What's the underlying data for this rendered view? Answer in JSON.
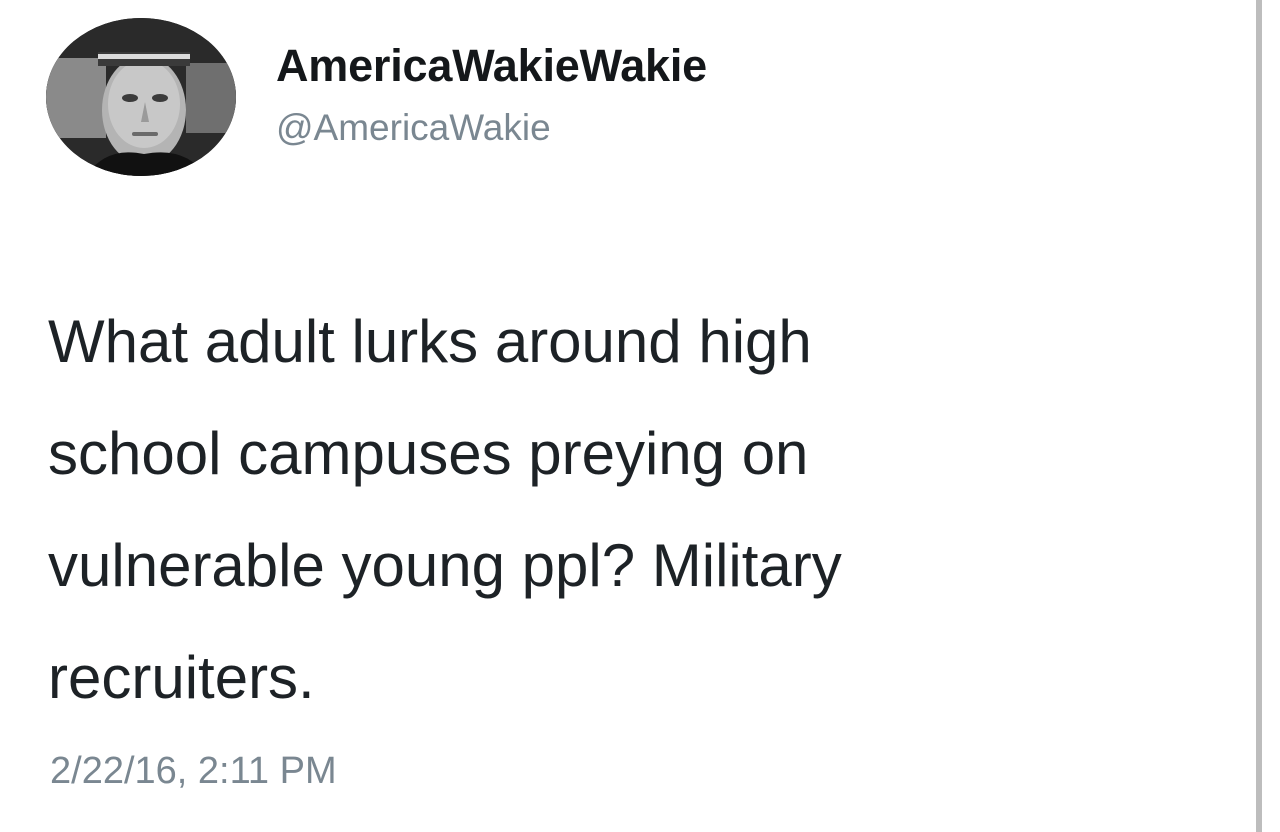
{
  "tweet": {
    "author": {
      "display_name": "AmericaWakieWakie",
      "handle": "@AmericaWakie",
      "avatar_icon": "profile-photo-icon"
    },
    "text_lines": [
      "What adult lurks around high",
      "school campuses preying on",
      "vulnerable young ppl? Military",
      "recruiters."
    ],
    "timestamp": "2/22/16, 2:11 PM"
  },
  "colors": {
    "name": "#14171a",
    "secondary": "#7a8791",
    "body_text": "#1d2226",
    "background": "#ffffff"
  }
}
